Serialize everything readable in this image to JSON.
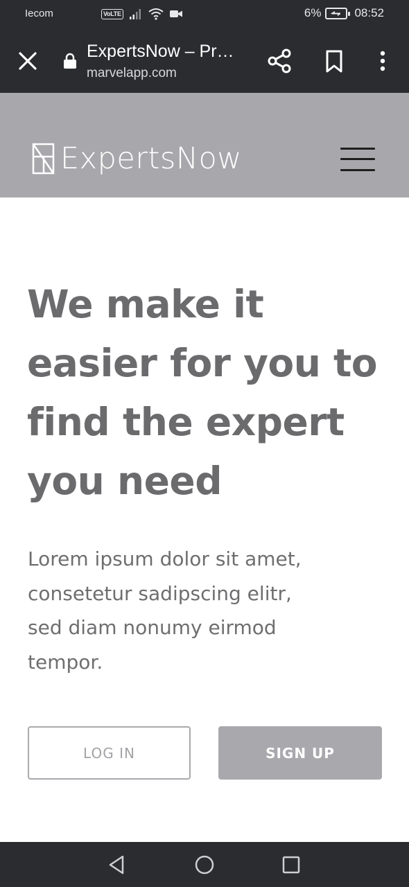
{
  "status_bar": {
    "carrier": "Iecom",
    "volte": "VoLTE",
    "battery_percent": "6%",
    "time": "08:52"
  },
  "browser": {
    "page_title": "ExpertsNow – Pr…",
    "url": "marvelapp.com",
    "icons": [
      "close-icon",
      "lock-icon",
      "share-icon",
      "bookmark-icon",
      "more-vert-icon"
    ]
  },
  "site_header": {
    "brand": "ExpertsNow",
    "menu_icon": "hamburger-icon"
  },
  "hero": {
    "title": "We make it easier for you to find the expert you need",
    "description": "Lorem ipsum dolor sit amet, consetetur sadipscing elitr, sed diam nonumy eirmod tempor."
  },
  "buttons": {
    "login": "LOG IN",
    "signup": "SIGN UP"
  },
  "nav_bar": {
    "icons": [
      "back-icon",
      "home-icon",
      "recents-icon"
    ]
  },
  "colors": {
    "system_bar": "#2b2c30",
    "header_bg": "#a8a8ac",
    "text_gray": "#6b6b6d",
    "button_gray": "#a9a9ad"
  }
}
